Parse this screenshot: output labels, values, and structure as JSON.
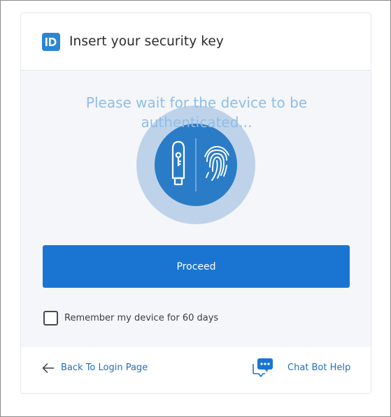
{
  "header": {
    "logo_text": "ID",
    "title": "Insert your security key"
  },
  "main": {
    "wait_message": "Please wait for the device to be authenticated...",
    "device_illustration": {
      "icons": [
        "usb-key-icon",
        "fingerprint-icon"
      ]
    },
    "proceed_label": "Proceed",
    "remember_label": "Remember my device for 60 days",
    "remember_checked": false
  },
  "footer": {
    "back_label": "Back To Login Page",
    "back_icon": "arrow-left-icon",
    "chat_label": "Chat Bot Help",
    "chat_icon": "chat-bubble-icon"
  },
  "colors": {
    "accent": "#1a75d2",
    "link": "#1f6fc1",
    "wait_text": "#8fbde6",
    "body_background": "#f4f6f9"
  }
}
